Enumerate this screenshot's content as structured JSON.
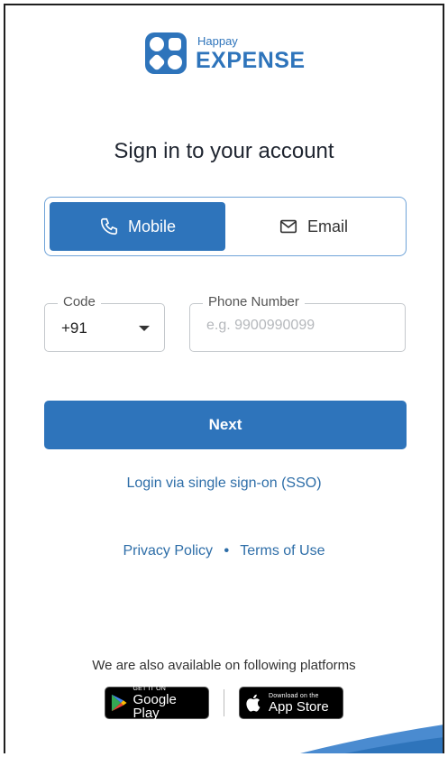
{
  "brand": {
    "small": "Happay",
    "big": "EXPENSE"
  },
  "title": "Sign in to your account",
  "tabs": {
    "mobile": "Mobile",
    "email": "Email"
  },
  "code": {
    "label": "Code",
    "value": "+91"
  },
  "phone": {
    "label": "Phone Number",
    "placeholder": "e.g. 9900990099"
  },
  "next_label": "Next",
  "sso_label": "Login via single sign-on (SSO)",
  "links": {
    "privacy": "Privacy Policy",
    "terms": "Terms of Use"
  },
  "platforms_text": "We are also available on following platforms",
  "stores": {
    "google_small": "GET IT ON",
    "google_big": "Google Play",
    "apple_small": "Download on the",
    "apple_big": "App Store"
  },
  "colors": {
    "primary": "#2e74bb",
    "link": "#2e6ea8"
  }
}
